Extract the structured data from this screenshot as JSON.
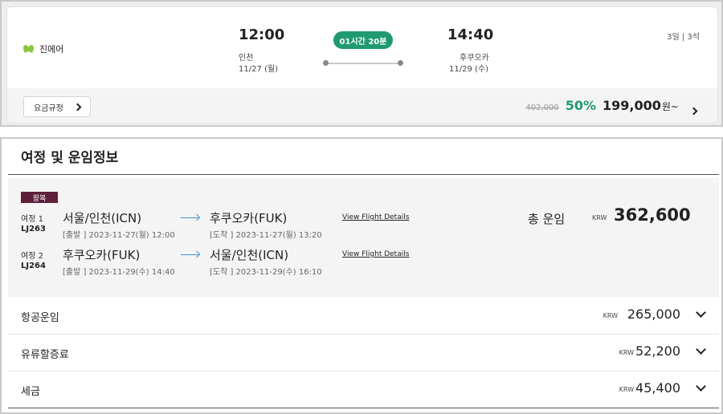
{
  "flight_card": {
    "airline": "진에어",
    "departure": {
      "time": "12:00",
      "city": "인천",
      "date": "11/27 (월)"
    },
    "duration": "01시간 20분",
    "arrival": {
      "time": "14:40",
      "city": "후쿠오카",
      "date": "11/29 (수)"
    },
    "stay_info": "3일 | 3석",
    "fare_rule_button": "요금규정",
    "original_price": "402,000",
    "discount": "50%",
    "price": "199,000",
    "price_unit": "원~",
    "accent_color": "#1f9a72"
  },
  "itinerary": {
    "title": "여정 및 운임정보",
    "trip_type": "왕복",
    "view_details_label": "View Flight Details",
    "segments": [
      {
        "label": "여정 1",
        "flight": "LJ263",
        "from": "서울/인천(ICN)",
        "to": "후쿠오카(FUK)",
        "depart": "[출발 ] 2023-11-27(월) 12:00",
        "arrive": "[도착 ] 2023-11-27(월) 13:20"
      },
      {
        "label": "여정 2",
        "flight": "LJ264",
        "from": "후쿠오카(FUK)",
        "to": "서울/인천(ICN)",
        "depart": "[출발 ] 2023-11-29(수) 14:40",
        "arrive": "[도착 ] 2023-11-29(수) 16:10"
      }
    ],
    "total_label": "총 운임",
    "total_currency": "KRW",
    "total_amount": "362,600",
    "fare_items": [
      {
        "label": "항공운임",
        "currency": "KRW",
        "amount": "265,000"
      },
      {
        "label": "유류할증료",
        "currency": "KRW",
        "amount": "52,200"
      },
      {
        "label": "세금",
        "currency": "KRW",
        "amount": "45,400"
      }
    ],
    "badge_color": "#5e1f3a"
  }
}
